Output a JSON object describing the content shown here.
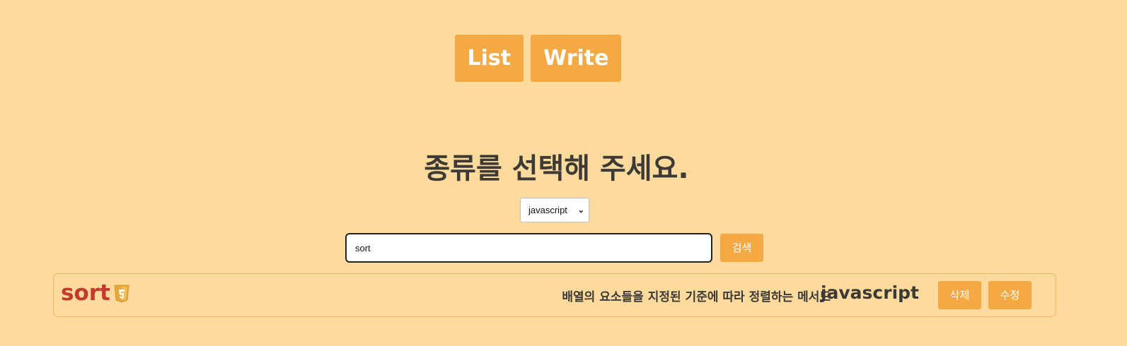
{
  "nav": {
    "list_label": "List",
    "write_label": "Write"
  },
  "heading": "종류를 선택해 주세요.",
  "kind_select": {
    "selected": "javascript"
  },
  "search": {
    "value": "sort",
    "button_label": "검색"
  },
  "results": [
    {
      "name": "sort",
      "icon": "javascript-icon",
      "description": "배열의 요소들을 지정된 기준에 따라 정렬하는 메서드",
      "kind": "javascript",
      "delete_label": "삭제",
      "edit_label": "수정"
    }
  ],
  "colors": {
    "background": "#FEDA9C",
    "accent": "#F5A945",
    "name": "#C23A2C",
    "card_border": "#F3B766"
  }
}
